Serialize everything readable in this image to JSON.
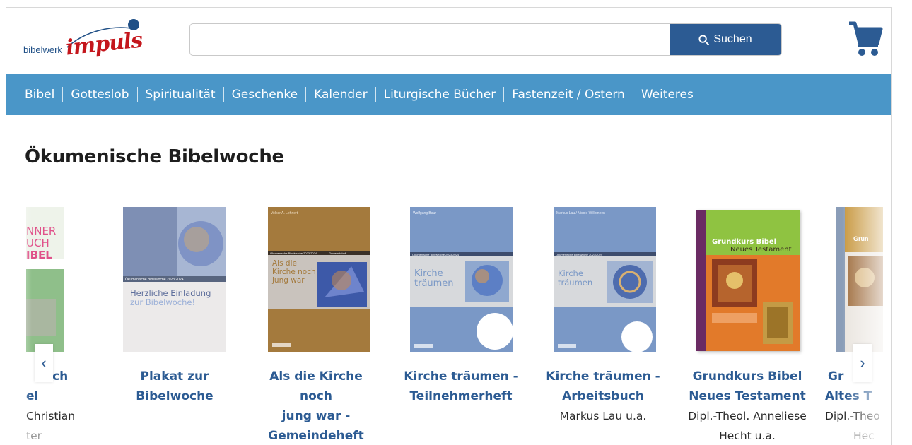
{
  "header": {
    "logo_text": "bibelwerk",
    "logo_script": "impuls",
    "search": {
      "placeholder": "",
      "value": "",
      "button_label": "Suchen"
    },
    "cart_icon": "cart-icon"
  },
  "nav": {
    "items": [
      {
        "label": "Bibel"
      },
      {
        "label": "Gotteslob"
      },
      {
        "label": "Spiritualität"
      },
      {
        "label": "Geschenke"
      },
      {
        "label": "Kalender"
      },
      {
        "label": "Liturgische Bücher"
      },
      {
        "label": "Fastenzeit / Ostern"
      },
      {
        "label": "Weiteres"
      }
    ]
  },
  "section": {
    "title": "Ökumenische Bibelwoche"
  },
  "products": [
    {
      "title_lines": [
        "uch",
        "el"
      ],
      "author_lines": [
        "Christian",
        "ter"
      ]
    },
    {
      "title_lines": [
        "Plakat zur",
        "Bibelwoche"
      ],
      "author_lines": []
    },
    {
      "title_lines": [
        "Als die Kirche noch",
        "jung war -",
        "Gemeindeheft"
      ],
      "author_lines": []
    },
    {
      "title_lines": [
        "Kirche träumen -",
        "Teilnehmerheft"
      ],
      "author_lines": []
    },
    {
      "title_lines": [
        "Kirche träumen -",
        "Arbeitsbuch"
      ],
      "author_lines": [
        "Markus Lau u.a."
      ]
    },
    {
      "title_lines": [
        "Grundkurs Bibel",
        "Neues Testament"
      ],
      "author_lines": [
        "Dipl.-Theol. Anneliese",
        "Hecht u.a."
      ]
    },
    {
      "title_lines": [
        "Gr",
        "Altes T"
      ],
      "author_lines": [
        "Dipl.-Theo",
        "Hec"
      ]
    }
  ],
  "covers": {
    "partial_left": {
      "lines": [
        "NNER",
        "UCH",
        "IBEL"
      ]
    },
    "plakat": {
      "series": "Ökumenische Bibelwoche 2023/2024",
      "line1": "Herzliche Einladung",
      "line2": "zur Bibelwoche!"
    },
    "gemeindeheft": {
      "author": "Volker A. Lehnert",
      "series": "Ökumenische Bibelwoche 2023/2024",
      "series_right": "Gemeindeheft",
      "title1": "Als die",
      "title2": "Kirche noch",
      "title3": "jung war"
    },
    "teilnehmerheft": {
      "author": "Wolfgang Baur",
      "series": "Ökumenische Bibelwoche 2023/2024",
      "title1": "Kirche",
      "title2": "träumen"
    },
    "arbeitsbuch": {
      "author": "Markus Lau / Nicole Willemeen",
      "series": "Ökumenische Bibelwoche 2023/2024",
      "title1": "Kirche",
      "title2": "träumen"
    },
    "grundkurs_nt": {
      "title1": "Grundkurs Bibel",
      "title2": "Neues Testament"
    },
    "partial_right": {
      "title": "Grun"
    }
  },
  "carousel": {
    "prev_label": "‹",
    "next_label": "›"
  }
}
